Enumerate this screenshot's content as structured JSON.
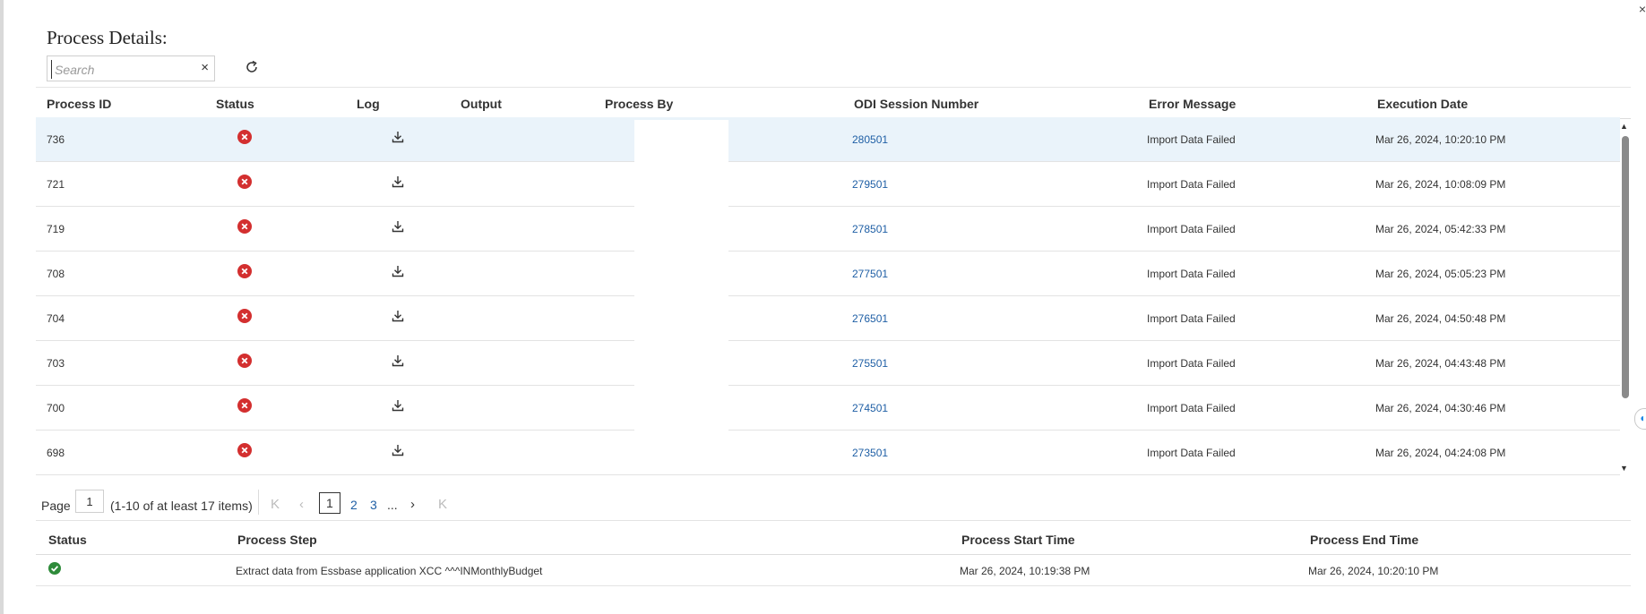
{
  "panel": {
    "title": "Process Details:",
    "close_glyph": "×"
  },
  "search": {
    "placeholder": "Search",
    "value": "",
    "clear_glyph": "×"
  },
  "icons": {
    "refresh": "refresh-icon",
    "status_failed": "error-circle-icon",
    "log": "download-icon",
    "status_success": "check-circle-icon"
  },
  "colors": {
    "failed": "#d32f2f",
    "success": "#2e8b3a",
    "link": "#1f5fa5",
    "selected_row": "#eaf3fa"
  },
  "processes": {
    "columns": [
      "Process ID",
      "Status",
      "Log",
      "Output",
      "Process By",
      "ODI Session Number",
      "Error Message",
      "Execution Date"
    ],
    "rows": [
      {
        "id": "736",
        "status": "failed",
        "session": "280501",
        "error": "Import Data Failed",
        "date": "Mar 26, 2024, 10:20:10 PM",
        "selected": true
      },
      {
        "id": "721",
        "status": "failed",
        "session": "279501",
        "error": "Import Data Failed",
        "date": "Mar 26, 2024, 10:08:09 PM"
      },
      {
        "id": "719",
        "status": "failed",
        "session": "278501",
        "error": "Import Data Failed",
        "date": "Mar 26, 2024, 05:42:33 PM"
      },
      {
        "id": "708",
        "status": "failed",
        "session": "277501",
        "error": "Import Data Failed",
        "date": "Mar 26, 2024, 05:05:23 PM"
      },
      {
        "id": "704",
        "status": "failed",
        "session": "276501",
        "error": "Import Data Failed",
        "date": "Mar 26, 2024, 04:50:48 PM"
      },
      {
        "id": "703",
        "status": "failed",
        "session": "275501",
        "error": "Import Data Failed",
        "date": "Mar 26, 2024, 04:43:48 PM"
      },
      {
        "id": "700",
        "status": "failed",
        "session": "274501",
        "error": "Import Data Failed",
        "date": "Mar 26, 2024, 04:30:46 PM"
      },
      {
        "id": "698",
        "status": "failed",
        "session": "273501",
        "error": "Import Data Failed",
        "date": "Mar 26, 2024, 04:24:08 PM"
      }
    ]
  },
  "pager": {
    "page_label": "Page",
    "page_value": "1",
    "range_text": "(1-10 of at least 17 items)",
    "pages": [
      "1",
      "2",
      "3"
    ],
    "ellipsis": "...",
    "first_glyph": "K",
    "prev_glyph": "‹",
    "next_glyph": "›",
    "last_glyph": "K"
  },
  "steps": {
    "columns": [
      "Status",
      "Process Step",
      "Process Start Time",
      "Process End Time"
    ],
    "rows": [
      {
        "status": "success",
        "step": "Extract data from Essbase application XCC  ^^^INMonthlyBudget",
        "start": "Mar 26, 2024, 10:19:38 PM",
        "end": "Mar 26, 2024, 10:20:10 PM"
      }
    ]
  },
  "scroll": {
    "up_glyph": "▲",
    "down_glyph": "▼"
  }
}
